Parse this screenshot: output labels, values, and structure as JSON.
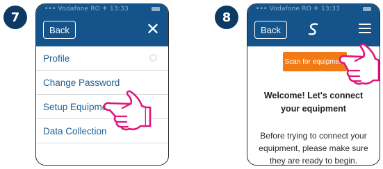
{
  "steps": {
    "left": "7",
    "right": "8"
  },
  "left_screen": {
    "status_text": "••• Vodafone RO ✈ 13:33",
    "back_label": "Back",
    "close_icon": "close-icon",
    "menu_items": [
      "Profile",
      "Change Password",
      "Setup Equipment",
      "Data Collection"
    ]
  },
  "right_screen": {
    "status_text": "••• Vodafone RO ✈ 13:33",
    "back_label": "Back",
    "logo_icon": "brand-logo-icon",
    "menu_icon": "hamburger-menu-icon",
    "scan_button": "Scan for equipment",
    "welcome": "Welcome! Let's connect your equipment",
    "description": "Before trying to connect your equipment, please make sure they are ready to begin."
  },
  "colors": {
    "header": "#14548a",
    "badge": "#0c3a63",
    "link": "#1f5f94",
    "scan_button": "#f27a16",
    "pointer_hand": "#e0147a"
  }
}
